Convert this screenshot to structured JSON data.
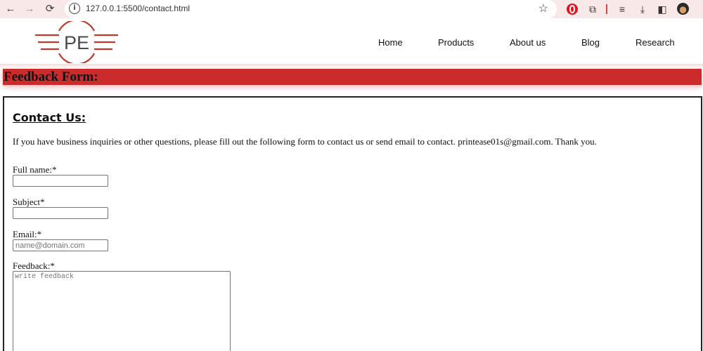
{
  "browser": {
    "url": "127.0.0.1:5500/contact.html",
    "icons": [
      "back-arrow-icon",
      "forward-arrow-icon",
      "reload-icon",
      "site-info-icon",
      "bookmark-star-icon",
      "opera-extension-icon",
      "puzzle-extensions-icon",
      "media-queue-icon",
      "download-icon",
      "side-panel-icon",
      "profile-avatar-icon"
    ]
  },
  "header": {
    "logo_text": "PE",
    "nav": [
      "Home",
      "Products",
      "About us",
      "Blog",
      "Research"
    ]
  },
  "banner": {
    "title": "Feedback Form:"
  },
  "form": {
    "heading": "Contact Us:",
    "intro": "If you have business inquiries or other questions, please fill out the following form to contact us or send email to contact. printease01s@gmail.com. Thank you.",
    "fullname_label": "Full name:*",
    "subject_label": "Subject*",
    "email_label": "Email:*",
    "email_placeholder": "name@domain.com",
    "feedback_label": "Feedback:*",
    "feedback_placeholder": "write feedback"
  },
  "colors": {
    "banner": "#cc2b2b",
    "logo": "#c0392b",
    "chrome": "#f8e8e8"
  }
}
